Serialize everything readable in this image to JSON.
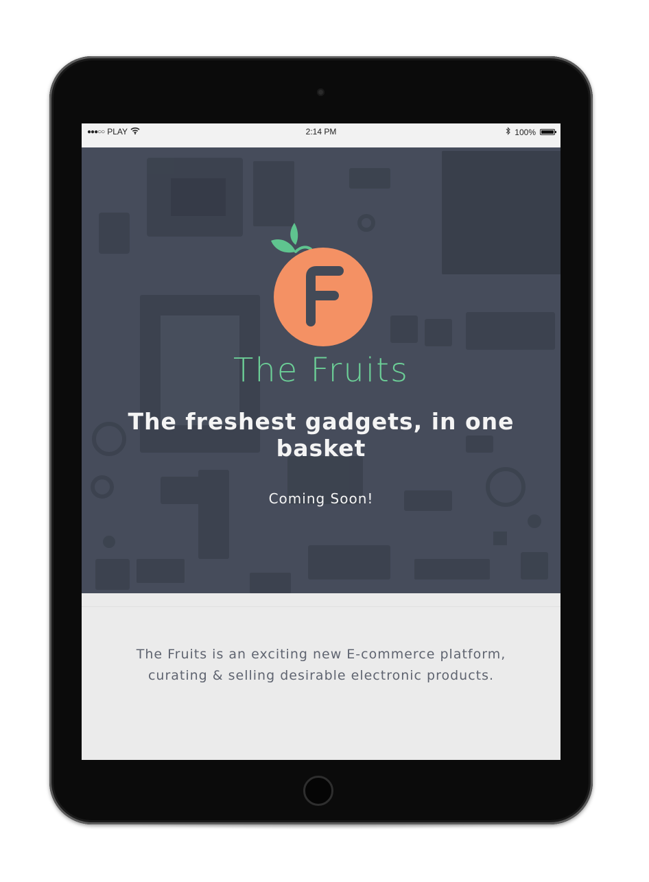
{
  "status_bar": {
    "carrier": "PLAY",
    "signal_icon": "signal-dots-icon",
    "wifi_icon": "wifi-icon",
    "time": "2:14 PM",
    "bluetooth_icon": "bluetooth-icon",
    "battery_percent": "100%",
    "battery_level": 1.0
  },
  "hero": {
    "logo_letter": "F",
    "brand_title": "The Fruits",
    "tagline": "The freshest gadgets, in one basket",
    "cta": "Coming Soon!"
  },
  "about": {
    "line1": "The Fruits is an exciting new E-commerce platform,",
    "line2": "curating & selling desirable electronic products."
  },
  "colors": {
    "accent_green": "#6ccf97",
    "logo_orange": "#f49164",
    "leaf_green": "#5fc48f",
    "hero_overlay": "#464d5a",
    "about_bg": "#ebebeb",
    "about_text": "#5f6470"
  }
}
